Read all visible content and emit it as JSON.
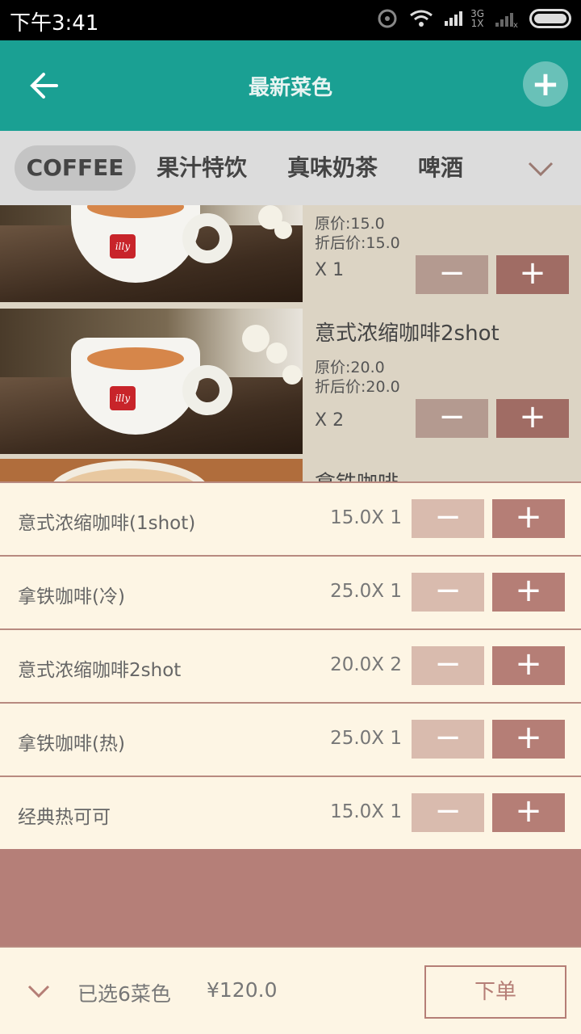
{
  "status_bar": {
    "time": "下午3:41",
    "network_top": "3G",
    "network_bottom": "1X"
  },
  "header": {
    "title": "最新菜色",
    "back_icon": "arrow-left-icon",
    "add_icon": "plus-icon"
  },
  "categories": {
    "items": [
      {
        "label": "COFFEE",
        "active": true
      },
      {
        "label": "果汁特饮",
        "active": false
      },
      {
        "label": "真味奶茶",
        "active": false
      },
      {
        "label": "啤酒",
        "active": false
      }
    ],
    "more_icon": "chevron-down-icon"
  },
  "menu": {
    "items": [
      {
        "name": "",
        "original_price": "原价:15.0",
        "discount_price": "折后价:15.0",
        "qty": "X 1",
        "minus": "−",
        "plus": "+"
      },
      {
        "name": "意式浓缩咖啡2shot",
        "original_price": "原价:20.0",
        "discount_price": "折后价:20.0",
        "qty": "X 2",
        "minus": "−",
        "plus": "+"
      },
      {
        "name": "拿铁咖啡"
      }
    ],
    "cup_logo": "illy"
  },
  "cart": {
    "items": [
      {
        "name": "意式浓缩咖啡(1shot)",
        "price": "15.0X 1"
      },
      {
        "name": "拿铁咖啡(冷)",
        "price": "25.0X 1"
      },
      {
        "name": "意式浓缩咖啡2shot",
        "price": "20.0X 2"
      },
      {
        "name": "拿铁咖啡(热)",
        "price": "25.0X 1"
      },
      {
        "name": "经典热可可",
        "price": "15.0X 1"
      }
    ],
    "minus": "−",
    "plus": "+"
  },
  "footer": {
    "selected": "已选6菜色",
    "total": "¥120.0",
    "order_button": "下单",
    "toggle_icon": "chevron-down-icon"
  },
  "colors": {
    "header": "#1aa093",
    "accent": "#b57e76",
    "cart_bg": "#fdf5e4"
  }
}
